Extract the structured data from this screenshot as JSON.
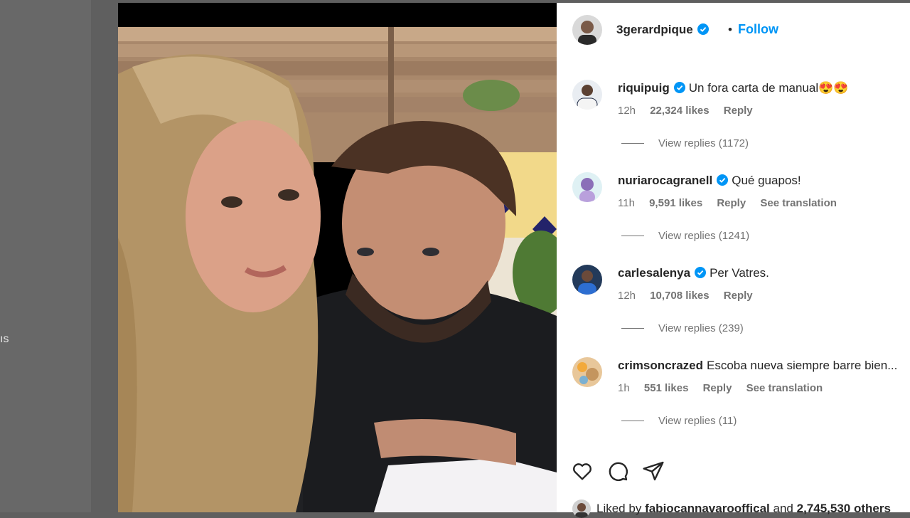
{
  "background": {
    "partial_text": "ıs"
  },
  "post": {
    "username": "3gerardpique",
    "dot": "•",
    "follow_label": "Follow"
  },
  "comments": [
    {
      "username": "riquipuig",
      "text": "Un fora carta de manual😍😍",
      "time": "12h",
      "likes": "22,324 likes",
      "reply": "Reply",
      "translation": "",
      "view_replies": "View replies (1172)"
    },
    {
      "username": "nuriarocagranell",
      "text": "Qué guapos!",
      "time": "11h",
      "likes": "9,591 likes",
      "reply": "Reply",
      "translation": "See translation",
      "view_replies": "View replies (1241)"
    },
    {
      "username": "carlesalenya",
      "text": "Per Vatres.",
      "time": "12h",
      "likes": "10,708 likes",
      "reply": "Reply",
      "translation": "",
      "view_replies": "View replies (239)"
    },
    {
      "username": "crimsoncrazed",
      "text": "Escoba nueva siempre barre bien...",
      "time": "1h",
      "likes": "551 likes",
      "reply": "Reply",
      "translation": "See translation",
      "view_replies": "View replies (11)"
    }
  ],
  "likes_line": {
    "prefix": "Liked by",
    "user": "fabiocannavarooffical",
    "middle": "and",
    "count": "2,745,530 others"
  },
  "icons": {
    "like": "heart-icon",
    "comment": "comment-icon",
    "share": "share-icon",
    "verified": "verified-badge-icon"
  },
  "colors": {
    "accent": "#0095f6",
    "verified": "#0095f6"
  }
}
